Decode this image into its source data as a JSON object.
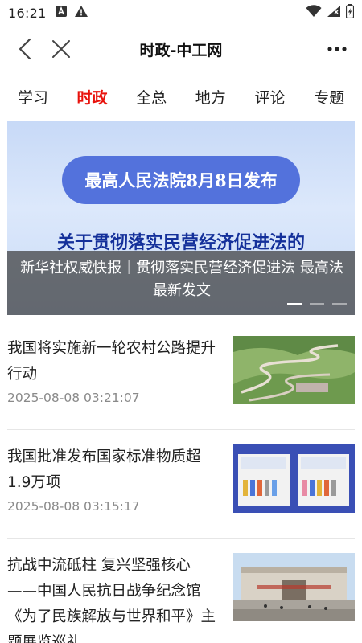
{
  "status_bar": {
    "time": "16:21",
    "left_icons": [
      "notification-a-icon",
      "warning-icon"
    ],
    "right_icons": [
      "wifi-icon",
      "signal-icon",
      "battery-icon"
    ]
  },
  "nav": {
    "title": "时政-中工网",
    "icons": [
      "back-icon",
      "close-icon",
      "more-icon"
    ]
  },
  "tabs": [
    {
      "label": "学习",
      "active": false
    },
    {
      "label": "时政",
      "active": true
    },
    {
      "label": "全总",
      "active": false
    },
    {
      "label": "地方",
      "active": false
    },
    {
      "label": "评论",
      "active": false
    },
    {
      "label": "专题",
      "active": false
    }
  ],
  "banner": {
    "pill_text": "最高人民法院8月8日发布",
    "headline": "关于贯彻落实民营经济促进法的",
    "caption": "新华社权威快报｜贯彻落实民营经济促进法 最高法最新发文",
    "slide_count": 3,
    "active_slide": 1
  },
  "news": [
    {
      "title": "我国将实施新一轮农村公路提升行动",
      "time": "2025-08-08 03:21:07",
      "thumb": "winding-road-photo"
    },
    {
      "title": "我国批准发布国家标准物质超1.9万项",
      "time": "2025-08-08 03:15:17",
      "thumb": "reference-material-kits-photo"
    },
    {
      "title": "抗战中流砥柱 复兴坚强核心——中国人民抗日战争纪念馆《为了民族解放与世界和平》主题展览巡礼",
      "time": "",
      "thumb": "memorial-hall-photo"
    }
  ],
  "colors": {
    "accent": "#e8120c",
    "banner_pill": "#5372dc",
    "banner_headline": "#14309a"
  }
}
